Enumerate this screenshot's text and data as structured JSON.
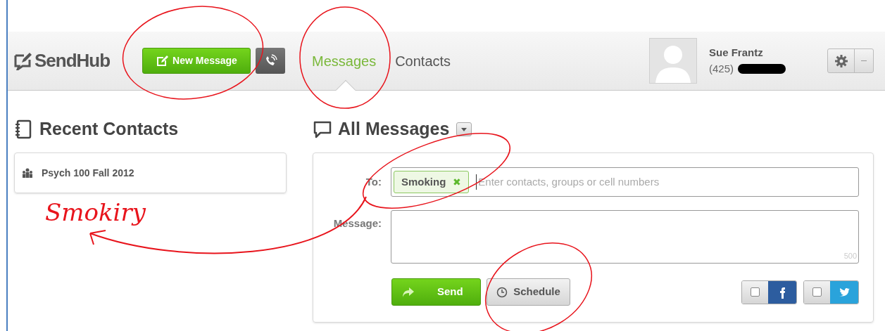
{
  "header": {
    "logo": "SendHub",
    "new_message_button": "New Message",
    "nav_tabs": [
      {
        "label": "Messages",
        "selected": true
      },
      {
        "label": "Contacts",
        "selected": false
      }
    ],
    "user": {
      "name": "Sue Frantz",
      "phone": "(425)"
    }
  },
  "recent_contacts": {
    "title": "Recent Contacts",
    "items": [
      {
        "label": "Psych 100 Fall 2012"
      }
    ]
  },
  "all_messages": {
    "title": "All Messages",
    "to_label": "To:",
    "recipients": [
      {
        "label": "Smoking",
        "remove": "✖"
      }
    ],
    "to_placeholder": "Enter contacts, groups or cell numbers",
    "message_label": "Message:",
    "char_count": "500",
    "send_button": "Send",
    "schedule_button": "Schedule",
    "share": [
      {
        "kind": "facebook",
        "checked": false
      },
      {
        "kind": "twitter",
        "checked": false
      }
    ]
  },
  "handwritten_note": "Smokiry"
}
